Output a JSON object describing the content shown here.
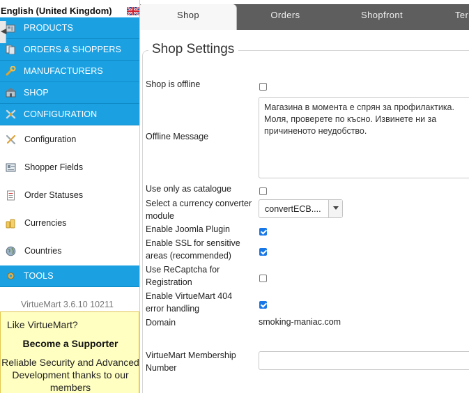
{
  "language": {
    "label": "English (United Kingdom)",
    "flag_icon": "uk-flag-icon"
  },
  "sidebar": {
    "blue_items": [
      {
        "label": "PRODUCTS",
        "icon": "products-icon"
      },
      {
        "label": "ORDERS & SHOPPERS",
        "icon": "orders-icon"
      },
      {
        "label": "MANUFACTURERS",
        "icon": "wrench-icon"
      },
      {
        "label": "SHOP",
        "icon": "shop-icon"
      },
      {
        "label": "CONFIGURATION",
        "icon": "configuration-icon"
      }
    ],
    "config_items": [
      {
        "label": "Configuration",
        "icon": "tools-icon"
      },
      {
        "label": "Shopper Fields",
        "icon": "shopper-fields-icon"
      },
      {
        "label": "Order Statuses",
        "icon": "document-icon"
      },
      {
        "label": "Currencies",
        "icon": "coins-icon"
      },
      {
        "label": "Countries",
        "icon": "globe-icon"
      }
    ],
    "tools_item": {
      "label": "TOOLS",
      "icon": "tools-gear-icon"
    },
    "version": "VirtueMart 3.6.10 10211",
    "support": {
      "question": "Like VirtueMart?",
      "title": "Become a Supporter",
      "text": "Reliable Security and Advanced Development thanks to our members"
    }
  },
  "tabs": [
    {
      "label": "Shop",
      "active": true
    },
    {
      "label": "Orders",
      "active": false
    },
    {
      "label": "Shopfront",
      "active": false
    },
    {
      "label": "Ter",
      "active": false
    }
  ],
  "main": {
    "legend": "Shop Settings",
    "shop_offline": {
      "label": "Shop is offline",
      "checked": false
    },
    "offline_message": {
      "label": "Offline Message",
      "value": "Магазина в момента е спрян за профилактика. Моля, проверете по късно. Извинете ни за причиненото неудобство."
    },
    "use_as_catalogue": {
      "label": "Use only as catalogue",
      "checked": false
    },
    "currency_converter": {
      "label": "Select a currency converter module",
      "value": "convertECB...."
    },
    "joomla_plugin": {
      "label": "Enable Joomla Plugin",
      "checked": true
    },
    "ssl": {
      "label": "Enable SSL for sensitive areas (recommended)",
      "checked": true
    },
    "recaptcha": {
      "label": "Use ReCaptcha for Registration",
      "checked": false
    },
    "error_404": {
      "label": "Enable VirtueMart 404 error handling",
      "checked": true
    },
    "domain": {
      "label": "Domain",
      "value": "smoking-maniac.com"
    },
    "membership": {
      "label": "VirtueMart Membership Number",
      "value": ""
    }
  },
  "colors": {
    "nav_blue": "#1ba1e2",
    "tabbar": "#5e5e5e",
    "checkbox_checked": "#1877e6",
    "support_bg": "#ffffc2"
  }
}
